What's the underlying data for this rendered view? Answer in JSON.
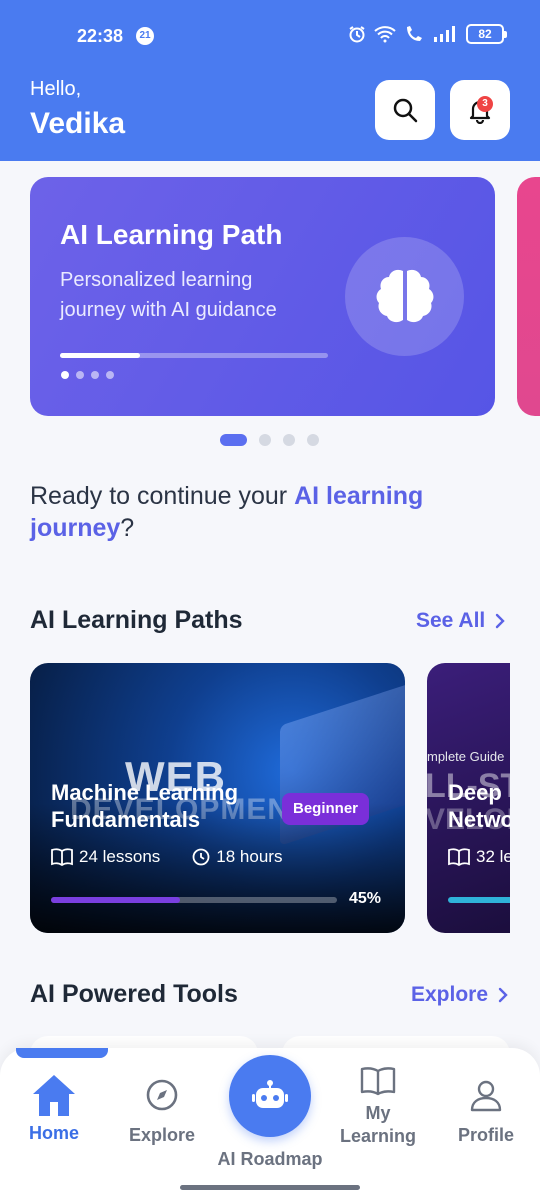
{
  "status_bar": {
    "time": "22:38",
    "badge": "21",
    "battery": "82"
  },
  "header": {
    "greeting": "Hello,",
    "username": "Vedika",
    "notification_count": "3"
  },
  "banner": {
    "title": "AI Learning Path",
    "subtitle": "Personalized learning journey with AI guidance",
    "progress": 0.3,
    "icon": "brain-icon"
  },
  "welcome": {
    "prefix": "Ready to continue your ",
    "highlight": "AI learning journey",
    "suffix": "?"
  },
  "learning_paths": {
    "title": "AI Learning Paths",
    "link": "See All",
    "courses": [
      {
        "title": "Machine Learning Fundamentals",
        "level": "Beginner",
        "lessons": "24 lessons",
        "duration": "18 hours",
        "progress_label": "45%",
        "progress": 0.45,
        "bg_word_1": "WEB",
        "bg_word_2": "DEVELOPMENT"
      },
      {
        "title": "Deep Netwo",
        "lessons": "32 le",
        "bg_text": "mplete Guide",
        "bg_big": "LL-STA",
        "bg_big_2": "VELOP"
      }
    ]
  },
  "tools": {
    "title": "AI Powered Tools",
    "link": "Explore"
  },
  "nav": {
    "home": "Home",
    "explore": "Explore",
    "roadmap": "AI Roadmap",
    "my_learning": "My Learning",
    "profile": "Profile"
  },
  "colors": {
    "primary": "#4a7bf0",
    "accent": "#5b62e6",
    "badge": "#7a2fd9"
  }
}
